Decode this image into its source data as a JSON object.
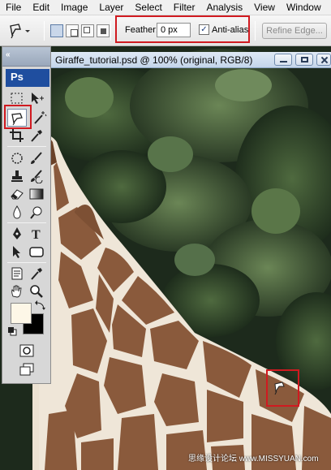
{
  "menubar": {
    "items": [
      "File",
      "Edit",
      "Image",
      "Layer",
      "Select",
      "Filter",
      "Analysis",
      "View",
      "Window"
    ]
  },
  "options_bar": {
    "active_tool_icon": "polygonal-lasso-icon",
    "feather_label": "Feather:",
    "feather_value": "0 px",
    "anti_alias_label": "Anti-alias",
    "anti_alias_checked": true,
    "refine_edge_label": "Refine Edge..."
  },
  "document": {
    "title": "Giraffe_tutorial.psd @ 100% (original, RGB/8)"
  },
  "toolbox": {
    "logo": "Ps",
    "active_tool": "polygonal-lasso",
    "foreground_color": "#fdf7e7",
    "background_color": "#000000"
  },
  "watermark": "思缘设计论坛 www.MISSYUAN.com",
  "colors": {
    "highlight": "#d01a20",
    "giraffe_patch": "#8a5a3c",
    "giraffe_line": "#efe6d8",
    "foliage_dark": "#1d2a1c"
  }
}
